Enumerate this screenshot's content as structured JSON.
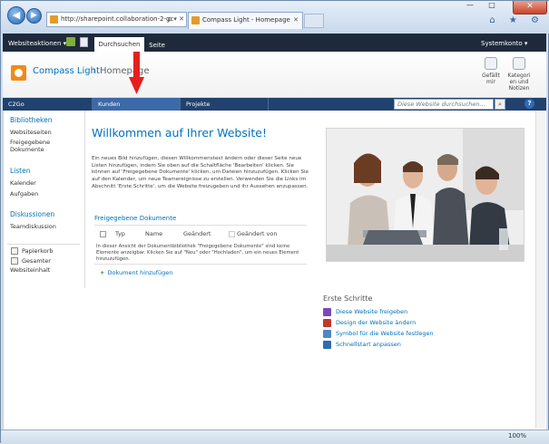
{
  "browser": {
    "address": "http://sharepoint.collaboration-2-gc",
    "address_controls": "ρ ▾ ✕",
    "tab_title": "Compass Light - Homepage",
    "tab_close": "✕",
    "status_zoom": "100%",
    "back_glyph": "◀",
    "forward_glyph": "▶",
    "minimize_glyph": "—",
    "maximize_glyph": "□",
    "close_glyph": "✕",
    "tools_glyphs": "⌂ ★ ⚙"
  },
  "ribbon": {
    "site_actions": "Websiteaktionen ▾",
    "tab_browse": "Durchsuchen",
    "tab_page": "Seite",
    "user": "Systemkonto ▾"
  },
  "header": {
    "site_title": "Compass Light",
    "separator": "›",
    "page_crumb": "Homepage",
    "like_label_1": "Gefällt",
    "like_label_2": "mir",
    "tags_label_1": "Kategori",
    "tags_label_2": "en und",
    "tags_label_3": "Notizen"
  },
  "topnav": {
    "items": [
      "C2Go",
      "Kunden",
      "Projekte"
    ],
    "search_placeholder": "Diese Website durchsuchen...",
    "search_glyph": "⌕",
    "help_glyph": "?"
  },
  "quicklaunch": {
    "libraries_heading": "Bibliotheken",
    "site_pages": "Websiteseiten",
    "shared_docs_1": "Freigegebene",
    "shared_docs_2": "Dokumente",
    "lists_heading": "Listen",
    "calendar": "Kalender",
    "tasks": "Aufgaben",
    "discussions_heading": "Diskussionen",
    "team_discussion": "Teamdiskussion",
    "recycle_bin": "Papierkorb",
    "all_content_1": "Gesamter",
    "all_content_2": "Websiteinhalt"
  },
  "main": {
    "welcome_title": "Willkommen auf Ihrer Website!",
    "intro_text": "Ein neues Bild hinzufügen, diesen Willkommenstext ändern oder dieser Seite neue Listen hinzufügen, indem Sie oben auf die Schaltfläche 'Bearbeiten' klicken. Sie können auf 'Freigegebene Dokumente' klicken, um Dateien hinzuzufügen. Klicken Sie auf den Kalender, um neue Teamereignisse zu erstellen. Verwenden Sie die Links im Abschnitt 'Erste Schritte', um die Website freizugeben und ihr Aussehen anzupassen.",
    "docs_heading": "Freigegebene Dokumente",
    "col_type": "Typ",
    "col_name": "Name",
    "col_modified": "Geändert",
    "col_modified_by": "Geändert von",
    "empty_text": "In dieser Ansicht der Dokumentbibliothek \"Freigegebene Dokumente\" sind keine Elemente anzeigbar. Klicken Sie auf \"Neu\" oder \"Hochladen\", um ein neues Element hinzuzufügen.",
    "add_document": "Dokument hinzufügen"
  },
  "getting_started": {
    "heading": "Erste Schritte",
    "links": [
      "Diese Website freigeben",
      "Design der Website ändern",
      "Symbol für die Website festlegen",
      "Schnellstart anpassen"
    ]
  }
}
